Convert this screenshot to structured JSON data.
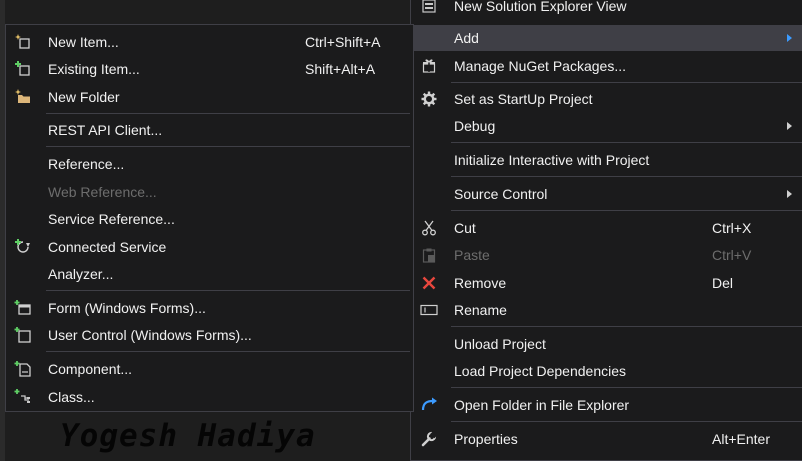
{
  "watermark": "Yogesh Hadiya",
  "submenu": {
    "new_item": {
      "label": "New Item...",
      "shortcut": "Ctrl+Shift+A"
    },
    "existing_item": {
      "label": "Existing Item...",
      "shortcut": "Shift+Alt+A"
    },
    "new_folder": {
      "label": "New Folder"
    },
    "rest_api_client": {
      "label": "REST API Client..."
    },
    "reference": {
      "label": "Reference..."
    },
    "web_reference": {
      "label": "Web Reference..."
    },
    "service_reference": {
      "label": "Service Reference..."
    },
    "connected_service": {
      "label": "Connected Service"
    },
    "analyzer": {
      "label": "Analyzer..."
    },
    "form": {
      "label": "Form (Windows Forms)..."
    },
    "user_control": {
      "label": "User Control (Windows Forms)..."
    },
    "component": {
      "label": "Component..."
    },
    "class": {
      "label": "Class..."
    }
  },
  "mainmenu": {
    "new_solution_explorer_view": {
      "label": "New Solution Explorer View"
    },
    "add": {
      "label": "Add"
    },
    "manage_nuget": {
      "label": "Manage NuGet Packages..."
    },
    "set_startup": {
      "label": "Set as StartUp Project"
    },
    "debug": {
      "label": "Debug"
    },
    "initialize_interactive": {
      "label": "Initialize Interactive with Project"
    },
    "source_control": {
      "label": "Source Control"
    },
    "cut": {
      "label": "Cut",
      "shortcut": "Ctrl+X"
    },
    "paste": {
      "label": "Paste",
      "shortcut": "Ctrl+V"
    },
    "remove": {
      "label": "Remove",
      "shortcut": "Del"
    },
    "rename": {
      "label": "Rename"
    },
    "unload_project": {
      "label": "Unload Project"
    },
    "load_dependencies": {
      "label": "Load Project Dependencies"
    },
    "open_folder": {
      "label": "Open Folder in File Explorer"
    },
    "properties": {
      "label": "Properties",
      "shortcut": "Alt+Enter"
    }
  },
  "colors": {
    "menu_bg": "#1b1b1c",
    "highlight": "#3f3f46",
    "separator": "#3f3f46",
    "text": "#f1f1f1",
    "disabled_text": "#6d6d6d",
    "accent_blue": "#3c9bff",
    "remove_red": "#e8473e",
    "folder_yellow": "#dcb67a"
  }
}
